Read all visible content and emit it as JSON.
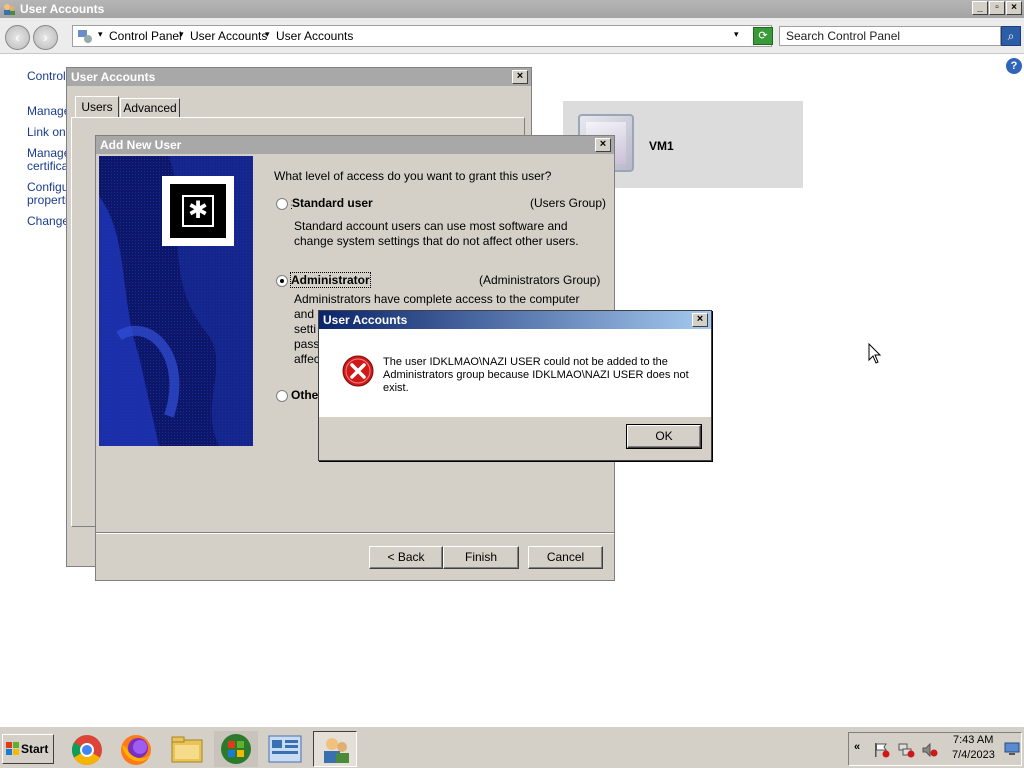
{
  "window": {
    "title": "User Accounts"
  },
  "address": {
    "crumbs": [
      "Control Panel",
      "User Accounts",
      "User Accounts"
    ]
  },
  "search": {
    "placeholder": "Search Control Panel"
  },
  "left_links": [
    "Control",
    "Manage",
    "Link onli",
    "Manage",
    "certifica",
    "Configu",
    "properti",
    "Change"
  ],
  "vm": {
    "name": "VM1"
  },
  "ua_dialog": {
    "title": "User Accounts",
    "tabs": [
      "Users",
      "Advanced"
    ]
  },
  "add_user": {
    "title": "Add New User",
    "question": "What level of access do you want to grant this user?",
    "standard_label": "Standard user",
    "standard_group": "(Users Group)",
    "standard_desc_1": "Standard account users can use most software and",
    "standard_desc_2": "change system settings that do not affect other users.",
    "admin_label": "Administrator",
    "admin_group": "(Administrators Group)",
    "admin_desc_1": "Administrators have complete access to the computer",
    "admin_frag": [
      "and",
      "setti",
      "pass",
      "affec"
    ],
    "other_label": "Othe",
    "back": "< Back",
    "finish": "Finish",
    "cancel": "Cancel"
  },
  "error_dialog": {
    "title": "User Accounts",
    "line1": "The user IDKLMAO\\NAZI USER could not be added to the",
    "line2": "Administrators group because IDKLMAO\\NAZI USER does not",
    "line3": "exist.",
    "ok": "OK"
  },
  "taskbar": {
    "start": "Start",
    "time": "7:43 AM",
    "date": "7/4/2023"
  },
  "colors": {
    "active_caption": "#0a246a",
    "inactive_caption": "#a8a8a8",
    "error_red": "#d01818",
    "link": "#1a3b8f"
  }
}
